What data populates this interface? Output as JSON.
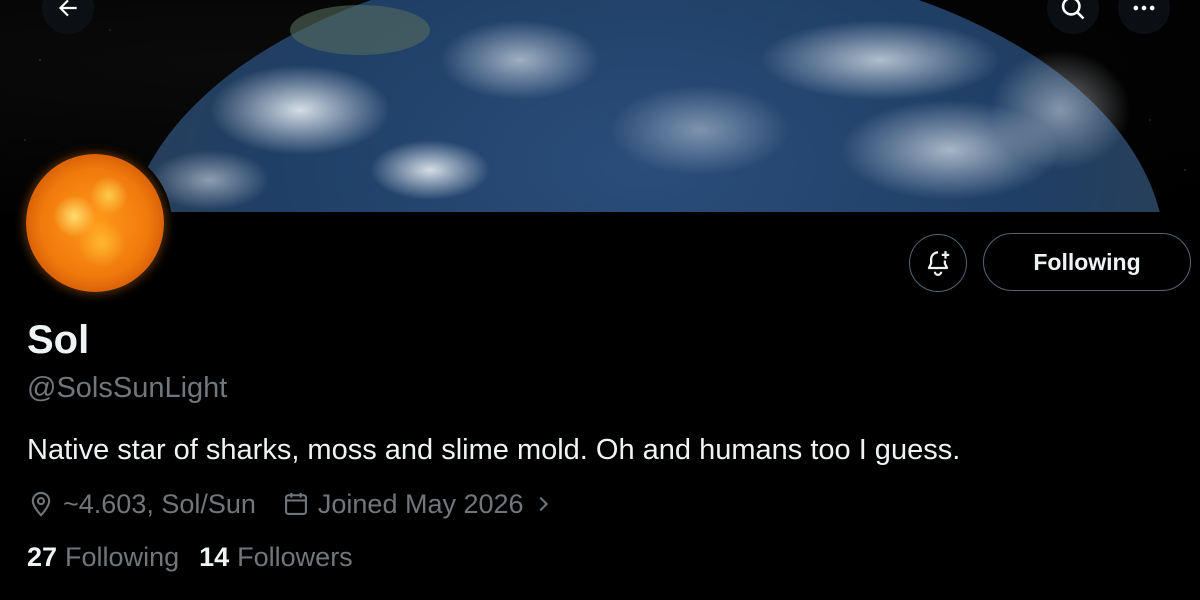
{
  "profile": {
    "display_name": "Sol",
    "handle": "@SolsSunLight",
    "bio": "Native star of sharks, moss and slime mold. Oh and humans too I guess.",
    "location": "~4.603, Sol/Sun",
    "joined": "Joined May 2026"
  },
  "actions": {
    "following_label": "Following"
  },
  "counts": {
    "following_count": "27",
    "following_label": "Following",
    "followers_count": "14",
    "followers_label": "Followers"
  },
  "icons": {
    "back": "arrow-left-icon",
    "search": "search-icon",
    "more": "more-icon",
    "notify": "bell-plus-icon",
    "location": "location-pin-icon",
    "calendar": "calendar-icon",
    "chevron": "chevron-right-icon"
  },
  "colors": {
    "background": "#000000",
    "text_primary": "#eff3f4",
    "text_secondary": "#71767b",
    "border": "#536471"
  }
}
